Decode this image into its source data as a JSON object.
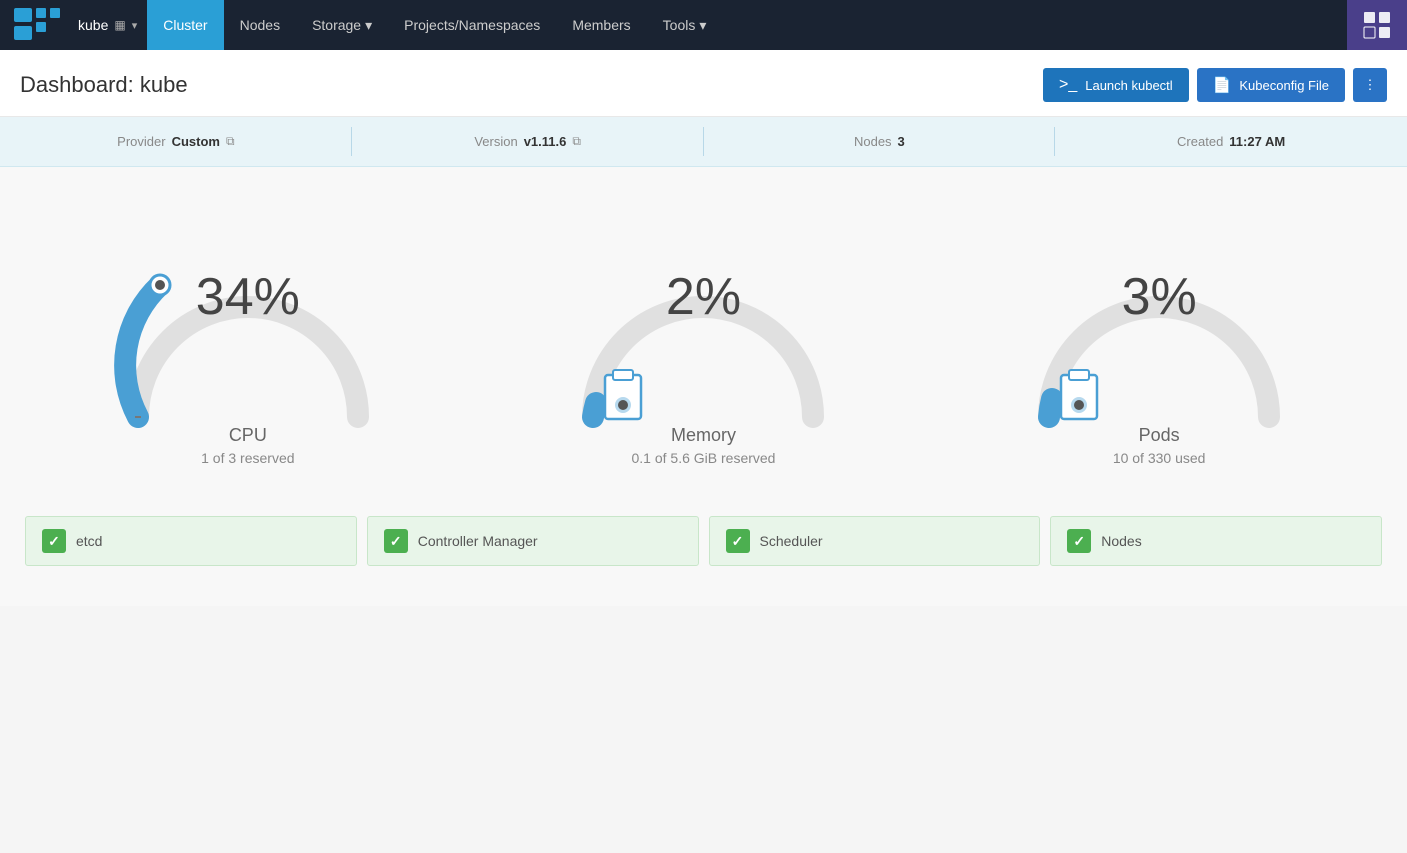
{
  "navbar": {
    "brand": "kube",
    "brand_icon": "▦",
    "nav_items": [
      {
        "label": "Cluster",
        "active": true
      },
      {
        "label": "Nodes",
        "active": false
      },
      {
        "label": "Storage",
        "active": false,
        "has_dropdown": true
      },
      {
        "label": "Projects/Namespaces",
        "active": false
      },
      {
        "label": "Members",
        "active": false
      },
      {
        "label": "Tools",
        "active": false,
        "has_dropdown": true
      }
    ]
  },
  "header": {
    "title": "Dashboard: kube",
    "btn_kubectl_label": "Launch kubectl",
    "btn_kubeconfig_label": "Kubeconfig File",
    "btn_dots_label": "⋮"
  },
  "info_bar": {
    "provider_label": "Provider",
    "provider_value": "Custom",
    "version_label": "Version",
    "version_value": "v1.11.6",
    "nodes_label": "Nodes",
    "nodes_value": "3",
    "created_label": "Created",
    "created_value": "11:27 AM"
  },
  "gauges": [
    {
      "id": "cpu",
      "percent": "34%",
      "label": "CPU",
      "sublabel": "1 of 3 reserved",
      "value": 34,
      "color": "#4a9fd4",
      "bg_color": "#e0e0e0"
    },
    {
      "id": "memory",
      "percent": "2%",
      "label": "Memory",
      "sublabel": "0.1 of 5.6 GiB reserved",
      "value": 2,
      "color": "#4a9fd4",
      "bg_color": "#e0e0e0"
    },
    {
      "id": "pods",
      "percent": "3%",
      "label": "Pods",
      "sublabel": "10 of 330 used",
      "value": 3,
      "color": "#4a9fd4",
      "bg_color": "#e0e0e0"
    }
  ],
  "status_items": [
    {
      "label": "etcd",
      "status": "ok"
    },
    {
      "label": "Controller Manager",
      "status": "ok"
    },
    {
      "label": "Scheduler",
      "status": "ok"
    },
    {
      "label": "Nodes",
      "status": "ok"
    }
  ]
}
